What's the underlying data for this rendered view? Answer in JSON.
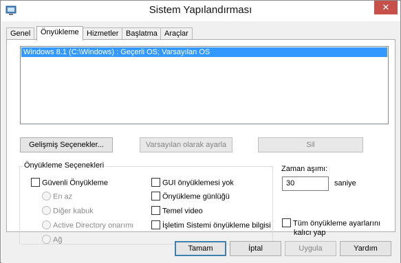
{
  "window": {
    "title": "Sistem Yapılandırması",
    "close_glyph": "✕"
  },
  "tabs": [
    {
      "label": "Genel",
      "active": false
    },
    {
      "label": "Önyükleme",
      "active": true
    },
    {
      "label": "Hizmetler",
      "active": false
    },
    {
      "label": "Başlatma",
      "active": false
    },
    {
      "label": "Araçlar",
      "active": false
    }
  ],
  "boot_list": {
    "items": [
      {
        "label": "Windows 8.1 (C:\\Windows) : Geçerli OS; Varsayılan OS",
        "selected": true
      }
    ]
  },
  "list_buttons": {
    "advanced": "Gelişmiş Seçenekler...",
    "set_default": "Varsayılan olarak ayarla",
    "delete": "Sil"
  },
  "boot_options": {
    "legend": "Önyükleme Seçenekleri",
    "safe_boot": {
      "label": "Güvenli Önyükleme",
      "checked": false
    },
    "safe_boot_modes": [
      {
        "label": "En az",
        "enabled": false
      },
      {
        "label": "Diğer kabuk",
        "enabled": false
      },
      {
        "label": "Active Directory onarımı",
        "enabled": false
      },
      {
        "label": "Ağ",
        "enabled": false
      }
    ],
    "right_checks": [
      {
        "label": "GUI önyüklemesi yok",
        "checked": false
      },
      {
        "label": "Önyükleme günlüğü",
        "checked": false
      },
      {
        "label": "Temel video",
        "checked": false
      },
      {
        "label": "İşletim Sistemi önyükleme bilgisi",
        "checked": false
      }
    ]
  },
  "timeout": {
    "label": "Zaman aşımı:",
    "value": "30",
    "unit": "saniye"
  },
  "permanent": {
    "label_line1": "Tüm önyükleme ayarlarını",
    "label_line2": "kalıcı yap",
    "checked": false
  },
  "footer": {
    "ok": "Tamam",
    "cancel": "İptal",
    "apply": "Uygula",
    "help": "Yardım"
  },
  "colors": {
    "selection": "#3399ff",
    "close_button": "#c7504b",
    "dialog_bg": "#f0f0f0"
  }
}
